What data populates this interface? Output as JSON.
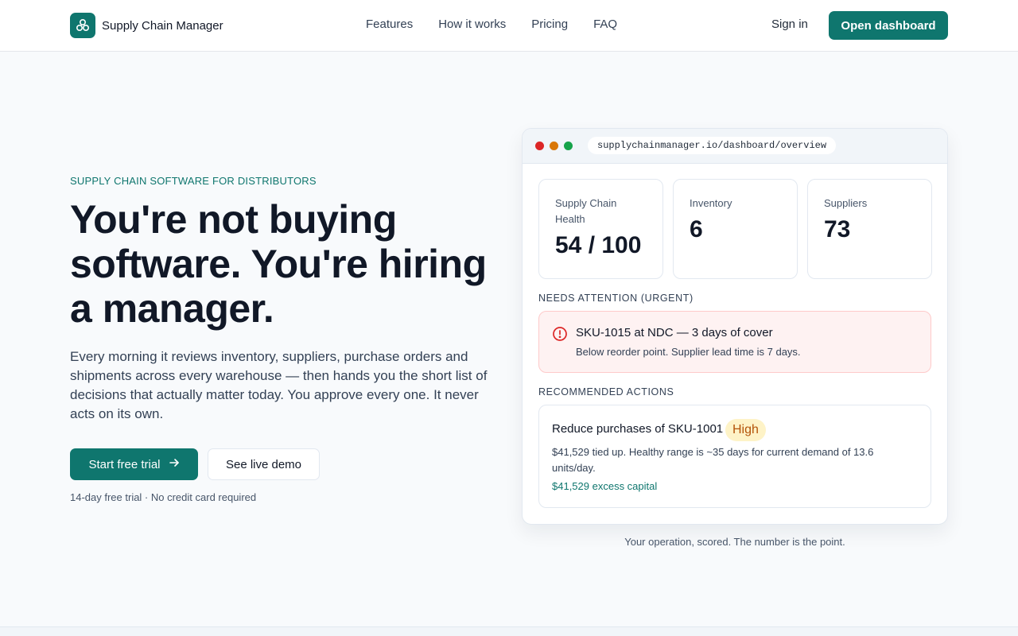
{
  "header": {
    "brand": "Supply Chain Manager",
    "nav": [
      "Features",
      "How it works",
      "Pricing",
      "FAQ"
    ],
    "sign_in": "Sign in",
    "open_dashboard": "Open dashboard"
  },
  "hero": {
    "eyebrow": "SUPPLY CHAIN SOFTWARE FOR DISTRIBUTORS",
    "headline": "You're not buying software. You're hiring a manager.",
    "lead": "Every morning it reviews inventory, suppliers, purchase orders and shipments across every warehouse — then hands you the short list of decisions that actually matter today. You approve every one. It never acts on its own.",
    "cta_primary": "Start free trial",
    "cta_secondary": "See live demo",
    "fineprint": "14-day free trial · No credit card required"
  },
  "mock": {
    "url": "supplychainmanager.io/dashboard/overview",
    "stats": [
      {
        "label": "Supply Chain Health",
        "value": "54 / 100"
      },
      {
        "label": "Inventory",
        "value": "6"
      },
      {
        "label": "Suppliers",
        "value": "73"
      }
    ],
    "urgent_label": "NEEDS ATTENTION (URGENT)",
    "alert_title": "SKU-1015 at NDC — 3 days of cover",
    "alert_sub": "Below reorder point. Supplier lead time is 7 days.",
    "actions_label": "RECOMMENDED ACTIONS",
    "action_title": "Reduce purchases of SKU-1001",
    "action_badge": "High",
    "action_sub": "$41,529 tied up. Healthy range is ~35 days for current demand of 13.6 units/day.",
    "action_foot": "$41,529 excess capital"
  },
  "caption": "Your operation, scored. The number is the point.",
  "icons": {
    "brand": "brand-logo-icon",
    "arrow": "arrow-right-icon",
    "alert": "alert-circle-icon"
  },
  "colors": {
    "brand": "#0f766e",
    "danger": "#dc2626",
    "warning": "#b45309"
  }
}
